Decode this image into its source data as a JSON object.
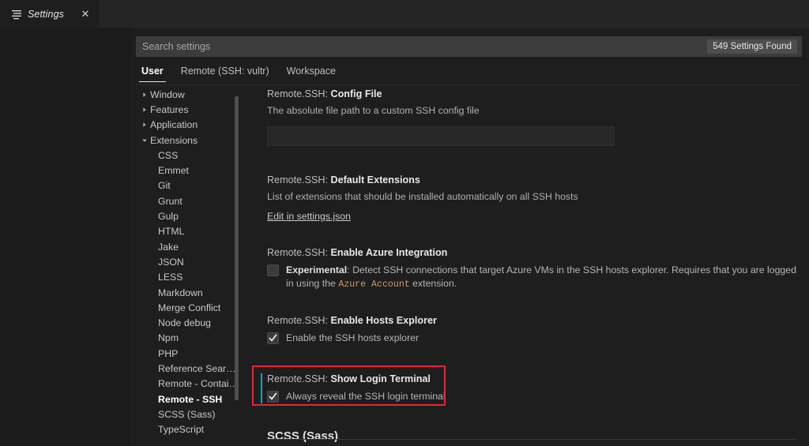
{
  "window": {
    "tab": {
      "icon": "settings-list-icon",
      "label": "Settings",
      "close_label": "✕"
    }
  },
  "search": {
    "placeholder": "Search settings",
    "value": "",
    "results_badge": "549 Settings Found"
  },
  "scope_tabs": [
    {
      "label": "User",
      "active": true
    },
    {
      "label": "Remote (SSH: vultr)",
      "active": false
    },
    {
      "label": "Workspace",
      "active": false
    }
  ],
  "toc": [
    {
      "label": "Window",
      "type": "group",
      "expanded": false,
      "selected": false
    },
    {
      "label": "Features",
      "type": "group",
      "expanded": false,
      "selected": false
    },
    {
      "label": "Application",
      "type": "group",
      "expanded": false,
      "selected": false
    },
    {
      "label": "Extensions",
      "type": "group",
      "expanded": true,
      "selected": false
    },
    {
      "label": "CSS",
      "type": "child",
      "selected": false
    },
    {
      "label": "Emmet",
      "type": "child",
      "selected": false
    },
    {
      "label": "Git",
      "type": "child",
      "selected": false
    },
    {
      "label": "Grunt",
      "type": "child",
      "selected": false
    },
    {
      "label": "Gulp",
      "type": "child",
      "selected": false
    },
    {
      "label": "HTML",
      "type": "child",
      "selected": false
    },
    {
      "label": "Jake",
      "type": "child",
      "selected": false
    },
    {
      "label": "JSON",
      "type": "child",
      "selected": false
    },
    {
      "label": "LESS",
      "type": "child",
      "selected": false
    },
    {
      "label": "Markdown",
      "type": "child",
      "selected": false
    },
    {
      "label": "Merge Conflict",
      "type": "child",
      "selected": false
    },
    {
      "label": "Node debug",
      "type": "child",
      "selected": false
    },
    {
      "label": "Npm",
      "type": "child",
      "selected": false
    },
    {
      "label": "PHP",
      "type": "child",
      "selected": false
    },
    {
      "label": "Reference Search V...",
      "type": "child",
      "selected": false
    },
    {
      "label": "Remote - Containers",
      "type": "child",
      "selected": false
    },
    {
      "label": "Remote - SSH",
      "type": "child",
      "selected": true
    },
    {
      "label": "SCSS (Sass)",
      "type": "child",
      "selected": false
    },
    {
      "label": "TypeScript",
      "type": "child",
      "selected": false
    }
  ],
  "settings": {
    "config_file": {
      "prefix": "Remote.SSH: ",
      "name": "Config File",
      "description": "The absolute file path to a custom SSH config file",
      "value": "",
      "placeholder": ""
    },
    "default_extensions": {
      "prefix": "Remote.SSH: ",
      "name": "Default Extensions",
      "description": "List of extensions that should be installed automatically on all SSH hosts",
      "link_label": "Edit in settings.json"
    },
    "enable_azure_integration": {
      "prefix": "Remote.SSH: ",
      "name": "Enable Azure Integration",
      "checked": false,
      "label_bold": "Experimental",
      "label_part1": ": Detect SSH connections that target Azure VMs in the SSH hosts explorer. Requires that you are logged in using the ",
      "label_code": "Azure Account",
      "label_part2": " extension."
    },
    "enable_hosts_explorer": {
      "prefix": "Remote.SSH: ",
      "name": "Enable Hosts Explorer",
      "checked": true,
      "label": "Enable the SSH hosts explorer"
    },
    "show_login_terminal": {
      "prefix": "Remote.SSH: ",
      "name": "Show Login Terminal",
      "checked": true,
      "label": "Always reveal the SSH login terminal",
      "focused": true
    }
  },
  "next_section": {
    "title": "SCSS (Sass)"
  },
  "colors": {
    "accent_focus": "#1a9fb5",
    "annotation": "#f4212e",
    "code_token": "#cf9b64",
    "editor_background": "#1e1e1e",
    "input_background": "#3c3c3c",
    "badge_background": "#4d4d4d"
  }
}
